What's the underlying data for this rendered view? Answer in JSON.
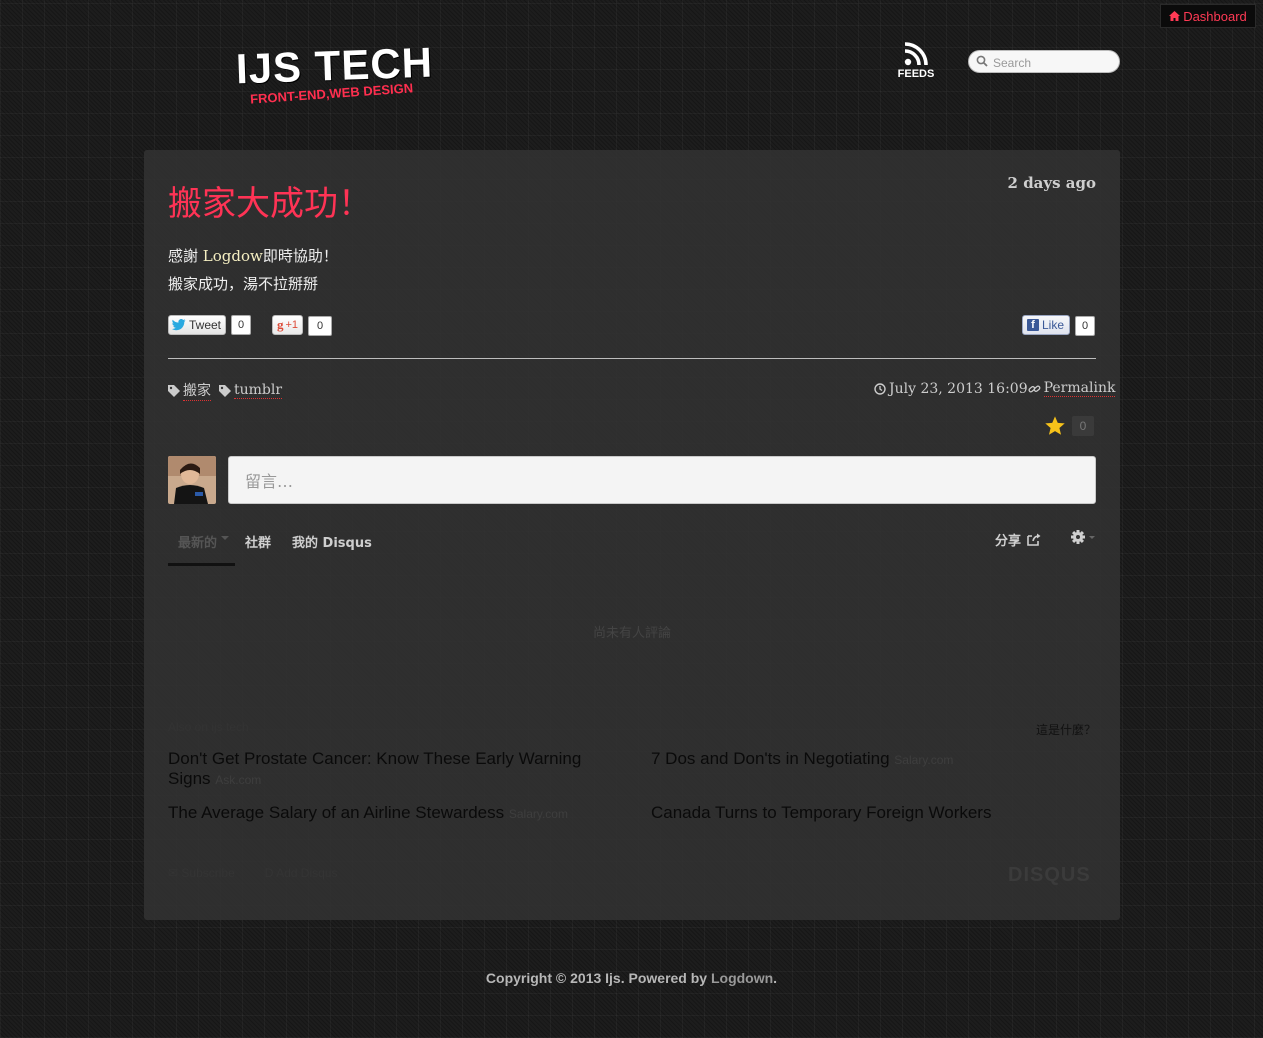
{
  "topbar": {
    "dashboard_label": "Dashboard"
  },
  "header": {
    "logo_title": "IJS TECH",
    "logo_subtitle": "FRONT-END,WEB DESIGN",
    "feeds_label": "FEEDS",
    "search_placeholder": "Search"
  },
  "post": {
    "title": "搬家大成功！",
    "time_ago": "2 days ago",
    "body": {
      "line1_prefix": "感謝 ",
      "line1_link": "Logdow",
      "line1_suffix": "即時協助！",
      "line2": "搬家成功，湯不拉掰掰"
    },
    "social": {
      "tweet_label": "Tweet",
      "tweet_count": "0",
      "gplus_label": "+1",
      "gplus_count": "0",
      "like_label": "Like",
      "like_count": "0"
    },
    "tags": [
      "搬家",
      "tumblr"
    ],
    "datetime": "July 23, 2013 16:09",
    "permalink_label": "Permalink"
  },
  "comments": {
    "star_count": "0",
    "input_placeholder": "留言…",
    "tabs": {
      "newest": "最新的",
      "community": "社群",
      "my_disqus": "我的 Disqus"
    },
    "share_label": "分享",
    "empty_text": "尚未有人評論",
    "also_on": "Also on ijs tech",
    "whats_this": "這是什麼？",
    "recommendations": [
      {
        "title": "Don't Get Prostate Cancer: Know These Early Warning Signs",
        "source": "Ask.com"
      },
      {
        "title": "7 Dos and Don'ts in Negotiating",
        "source": "Salary.com"
      },
      {
        "title": "The Average Salary of an Airline Stewardess",
        "source": "Salary.com"
      },
      {
        "title": "Canada Turns to Temporary Foreign Workers",
        "source": ""
      }
    ],
    "footer_subscribe": "Subscribe",
    "footer_add": "Add Disqus",
    "disqus_brand": "DISQUS"
  },
  "footer": {
    "copyright_prefix": "Copyright © 2013 Ijs. Powered by ",
    "powered_by": "Logdown",
    "copyright_suffix": "."
  }
}
